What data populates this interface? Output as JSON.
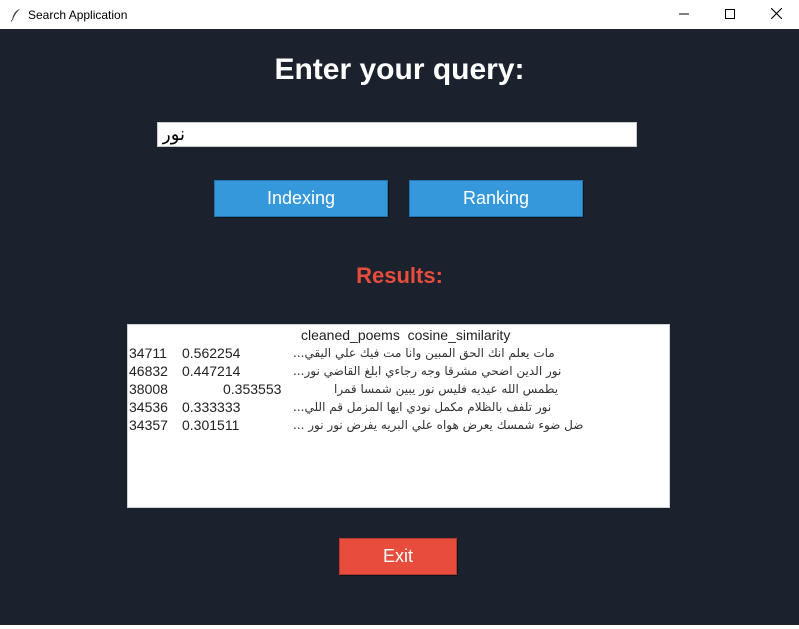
{
  "window": {
    "title": "Search Application",
    "controls": {
      "minimize_icon": "minimize-icon",
      "maximize_icon": "maximize-icon",
      "close_icon": "close-icon"
    }
  },
  "main": {
    "heading": "Enter your query:",
    "query": {
      "value": "نور",
      "placeholder": ""
    },
    "buttons": {
      "indexing_label": "Indexing",
      "ranking_label": "Ranking",
      "exit_label": "Exit"
    },
    "results_label": "Results:",
    "results": {
      "header": "cleaned_poems  cosine_similarity",
      "rows": [
        {
          "id": "34711",
          "score": "0.562254",
          "poem": "مات يعلم انك الحق المبين وانا مت فيك علي اليقي..."
        },
        {
          "id": "46832",
          "score": "0.447214",
          "poem": "نور الدين اضحي مشرقا وجه رجاءي ابلغ القاضي نور..."
        },
        {
          "id": "38008",
          "score": "0.353553",
          "poem": "يطمس الله عيديه فليس نور يبين شمسا قمرا"
        },
        {
          "id": "34536",
          "score": "0.333333",
          "poem": "نور تلفف بالظلام مكمل نودي ايها المزمل قم اللي..."
        },
        {
          "id": "34357",
          "score": "0.301511",
          "poem": "ضل ضوء شمسك يعرض هواه علي البريه يفرض نور نور ..."
        }
      ]
    }
  },
  "colors": {
    "background": "#1c222d",
    "button_blue": "#3498db",
    "button_red": "#e74c3c",
    "results_label": "#e74c3c",
    "heading": "#ffffff"
  }
}
